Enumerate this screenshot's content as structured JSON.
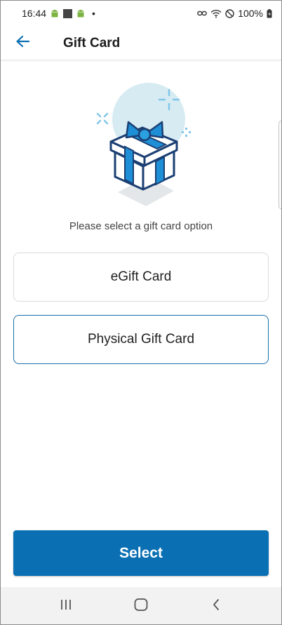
{
  "status_bar": {
    "time": "16:44",
    "dot": "•",
    "battery_percent": "100%"
  },
  "app_bar": {
    "title": "Gift Card"
  },
  "content": {
    "prompt": "Please select a gift card option",
    "options": [
      {
        "label": "eGift Card",
        "selected": false
      },
      {
        "label": "Physical Gift Card",
        "selected": true
      }
    ],
    "select_label": "Select"
  },
  "colors": {
    "primary": "#0a6fb3",
    "selected_border": "#1a6fae",
    "illustration_circle": "#d6ebf2",
    "gift_blue": "#1e8fd6",
    "gift_navy": "#1b3f73",
    "sparkle": "#7fc6e8"
  },
  "icons": {
    "back": "arrow-left-icon",
    "nav_recents": "recents-icon",
    "nav_home": "home-icon",
    "nav_back": "chevron-left-icon"
  }
}
